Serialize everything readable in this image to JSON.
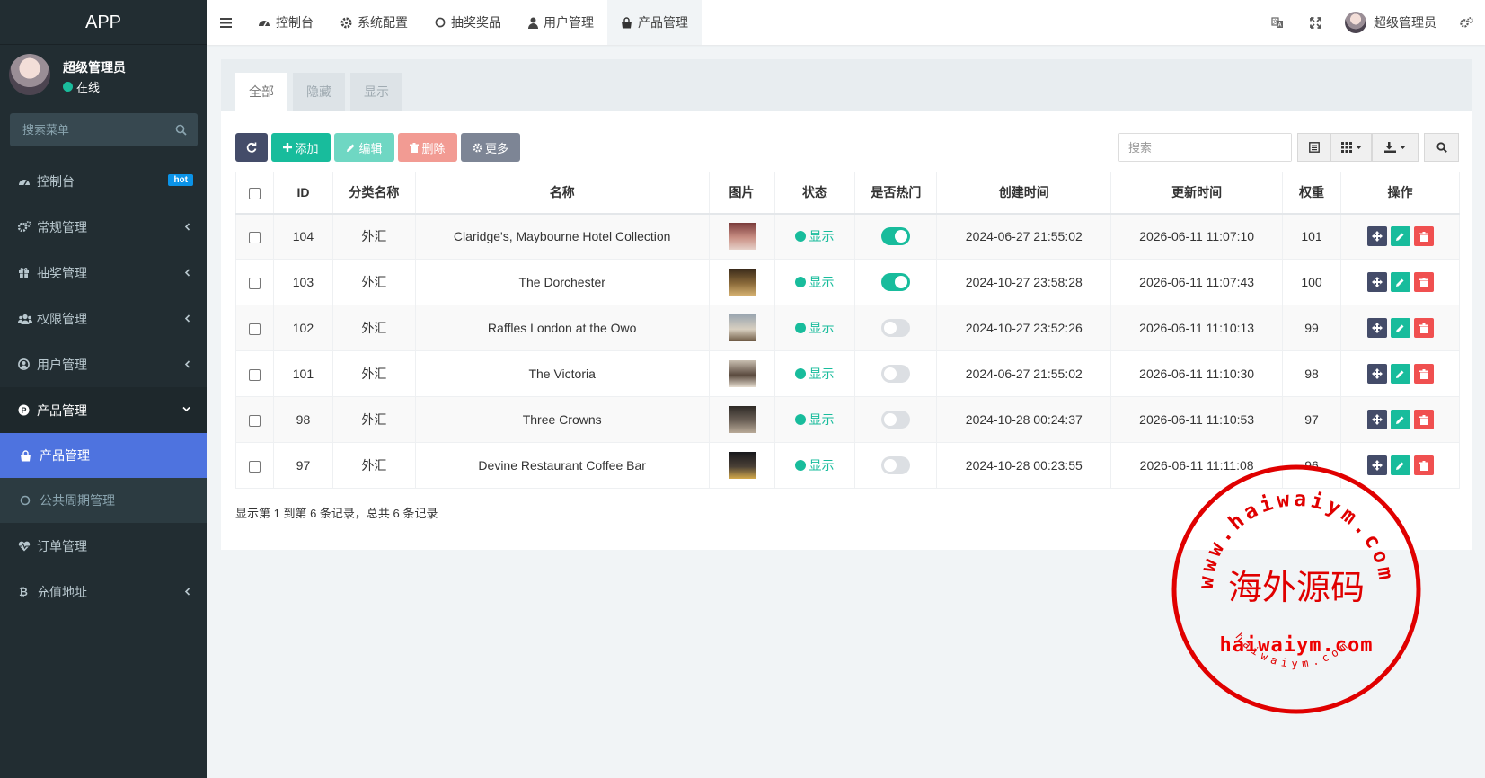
{
  "app": {
    "title": "APP"
  },
  "user": {
    "name": "超级管理员",
    "status": "在线"
  },
  "menu_search": {
    "placeholder": "搜索菜单"
  },
  "menu": [
    {
      "label": "控制台",
      "badge": "hot"
    },
    {
      "label": "常规管理"
    },
    {
      "label": "抽奖管理"
    },
    {
      "label": "权限管理"
    },
    {
      "label": "用户管理"
    },
    {
      "label": "产品管理"
    },
    {
      "label": "订单管理"
    },
    {
      "label": "充值地址"
    }
  ],
  "submenu": [
    {
      "label": "产品管理",
      "active": true
    },
    {
      "label": "公共周期管理"
    }
  ],
  "nav_tabs": [
    {
      "label": "控制台"
    },
    {
      "label": "系统配置"
    },
    {
      "label": "抽奖奖品"
    },
    {
      "label": "用户管理"
    },
    {
      "label": "产品管理",
      "active": true
    }
  ],
  "header_user": {
    "name": "超级管理员"
  },
  "panel_tabs": [
    {
      "label": "全部",
      "active": true
    },
    {
      "label": "隐藏"
    },
    {
      "label": "显示"
    }
  ],
  "toolbar": {
    "add": "添加",
    "edit": "编辑",
    "delete": "删除",
    "more": "更多",
    "search_placeholder": "搜索"
  },
  "table": {
    "headers": [
      "ID",
      "分类名称",
      "名称",
      "图片",
      "状态",
      "是否热门",
      "创建时间",
      "更新时间",
      "权重",
      "操作"
    ],
    "rows": [
      {
        "id": "104",
        "category": "外汇",
        "name": "Claridge's, Maybourne Hotel Collection",
        "status": "显示",
        "hot": true,
        "created": "2024-06-27 21:55:02",
        "updated": "2026-06-11 11:07:10",
        "weight": "101"
      },
      {
        "id": "103",
        "category": "外汇",
        "name": "The Dorchester",
        "status": "显示",
        "hot": true,
        "created": "2024-10-27 23:58:28",
        "updated": "2026-06-11 11:07:43",
        "weight": "100"
      },
      {
        "id": "102",
        "category": "外汇",
        "name": "Raffles London at the Owo",
        "status": "显示",
        "hot": false,
        "created": "2024-10-27 23:52:26",
        "updated": "2026-06-11 11:10:13",
        "weight": "99"
      },
      {
        "id": "101",
        "category": "外汇",
        "name": "The Victoria",
        "status": "显示",
        "hot": false,
        "created": "2024-06-27 21:55:02",
        "updated": "2026-06-11 11:10:30",
        "weight": "98"
      },
      {
        "id": "98",
        "category": "外汇",
        "name": "Three Crowns",
        "status": "显示",
        "hot": false,
        "created": "2024-10-28 00:24:37",
        "updated": "2026-06-11 11:10:53",
        "weight": "97"
      },
      {
        "id": "97",
        "category": "外汇",
        "name": "Devine Restaurant Coffee Bar",
        "status": "显示",
        "hot": false,
        "created": "2024-10-28 00:23:55",
        "updated": "2026-06-11 11:11:08",
        "weight": "96"
      }
    ]
  },
  "footer": {
    "summary": "显示第 1 到第 6 条记录，总共 6 条记录"
  },
  "watermark": {
    "ring_text": "www.haiwaiym.com",
    "center": "海外源码",
    "url": "haiwaiym.com",
    "small": "haiwaiym.com"
  },
  "colors": {
    "sidebar": "#222d32",
    "active": "#4e73df",
    "green": "#18bc9c",
    "dark": "#444c69",
    "red": "#f05050",
    "stamp": "#e00000"
  }
}
